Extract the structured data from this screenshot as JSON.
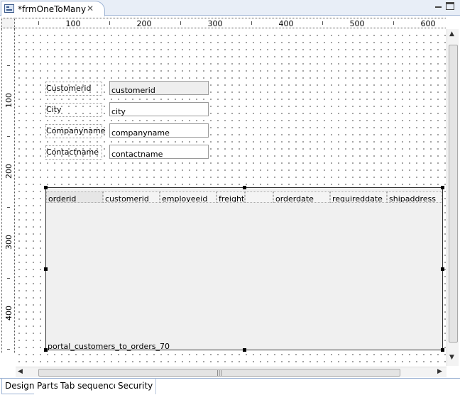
{
  "editor": {
    "tab_title": "*frmOneToMany",
    "close_glyph": "✕",
    "tab_icon": "form-icon"
  },
  "rulers": {
    "horizontal_labels": [
      "100",
      "200",
      "300",
      "400",
      "500",
      "600"
    ],
    "vertical_labels": [
      "100",
      "200",
      "300",
      "400"
    ]
  },
  "form": {
    "labels": [
      "Customerid",
      "City",
      "Companyname",
      "Contactname"
    ],
    "fields": [
      "customerid",
      "city",
      "companyname",
      "contactname"
    ]
  },
  "portal": {
    "name": "portal_customers_to_orders_70",
    "columns": [
      "orderid",
      "customerid",
      "employeeid",
      "freight",
      "",
      "orderdate",
      "requireddate",
      "shipaddress"
    ]
  },
  "scrollbars": {
    "grip_glyph": "|||",
    "up_glyph": "▲",
    "down_glyph": "▼",
    "left_glyph": "◀",
    "right_glyph": "▶"
  },
  "bottom_tabs": [
    "Design",
    "Parts",
    "Tab sequence",
    "Security"
  ],
  "colors": {
    "tab_border": "#9db3d4",
    "portal_bg": "#f0f0f0",
    "readonly_field_bg": "#eeeeee"
  }
}
